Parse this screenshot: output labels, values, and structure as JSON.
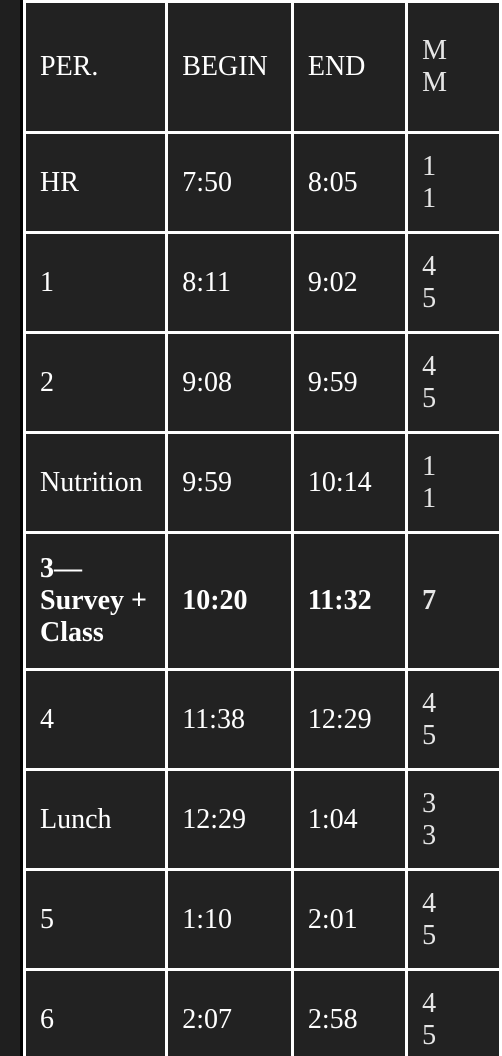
{
  "table": {
    "headers": [
      "PER.",
      "BEGIN",
      "END",
      "M\nM"
    ],
    "rows": [
      {
        "period": "HR",
        "begin": "7:50",
        "end": "8:05",
        "mins": "1\n1",
        "bold": false
      },
      {
        "period": "1",
        "begin": "8:11",
        "end": "9:02",
        "mins": "4\n5",
        "bold": false
      },
      {
        "period": "2",
        "begin": "9:08",
        "end": "9:59",
        "mins": "4\n5",
        "bold": false
      },
      {
        "period": "Nutrition",
        "begin": "9:59",
        "end": "10:14",
        "mins": "1\n1",
        "bold": false
      },
      {
        "period": "3—Survey + Class",
        "begin": "10:20",
        "end": "11:32",
        "mins": "7",
        "bold": true
      },
      {
        "period": "4",
        "begin": "11:38",
        "end": "12:29",
        "mins": "4\n5",
        "bold": false
      },
      {
        "period": "Lunch",
        "begin": "12:29",
        "end": "1:04",
        "mins": "3\n3",
        "bold": false
      },
      {
        "period": "5",
        "begin": "1:10",
        "end": "2:01",
        "mins": "4\n5",
        "bold": false
      },
      {
        "period": "6",
        "begin": "2:07",
        "end": "2:58",
        "mins": "4\n5",
        "bold": false
      }
    ]
  }
}
